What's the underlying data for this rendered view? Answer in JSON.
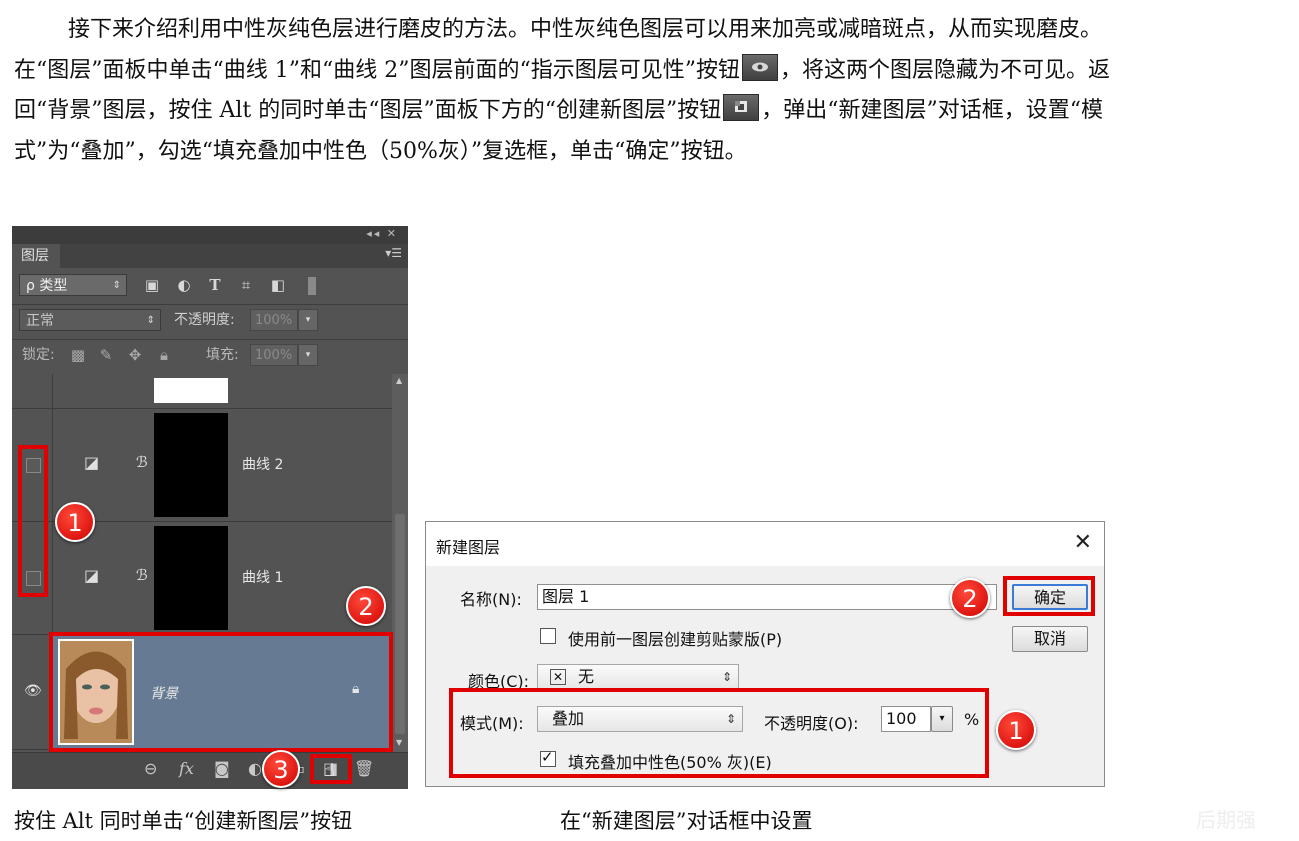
{
  "paragraph": {
    "part1": "接下来介绍利用中性灰纯色层进行磨皮的方法。中性灰纯色图层可以用来加亮或减暗斑点，从而实现磨皮。在“图层”面板中单击“曲线 1”和“曲线 2”图层前面的“指示图层可见性”按钮",
    "part2": "，将这两个图层隐藏为不可见。返回“背景”图层，按住 Alt 的同时单击“图层”面板下方的“创建新图层”按钮",
    "part3": "，弹出“新建图层”对话框，设置“模式”为“叠加”，勾选“填充叠加中性色（50%灰）”复选框，单击“确定”按钮。"
  },
  "layers_panel": {
    "tab": "图层",
    "filter_type": "ρ 类型",
    "blend_mode": "正常",
    "opacity_label": "不透明度:",
    "opacity_value": "100%",
    "lock_label": "锁定:",
    "fill_label": "填充:",
    "fill_value": "100%",
    "layers": [
      {
        "name": "曲线 2",
        "visible": false
      },
      {
        "name": "曲线 1",
        "visible": false
      },
      {
        "name": "背景",
        "visible": true,
        "selected": true
      }
    ]
  },
  "dialog": {
    "title": "新建图层",
    "name_label": "名称(N):",
    "name_value": "图层 1",
    "clip_label": "使用前一图层创建剪贴蒙版(P)",
    "color_label": "颜色(C):",
    "color_value": "无",
    "mode_label": "模式(M):",
    "mode_value": "叠加",
    "opacity_label": "不透明度(O):",
    "opacity_value": "100",
    "opacity_unit": "%",
    "fill_label": "填充叠加中性色(50% 灰)(E)",
    "ok_label": "确定",
    "cancel_label": "取消"
  },
  "badges": {
    "panel_visibility": "1",
    "panel_background": "2",
    "panel_new_layer": "3",
    "dialog_mode": "1",
    "dialog_ok": "2"
  },
  "captions": {
    "left": "按住 Alt 同时单击“创建新图层”按钮",
    "right": "在“新建图层”对话框中设置"
  },
  "watermark": "后期强",
  "colors": {
    "highlight_red": "#e10000",
    "selected_layer": "#667a93",
    "panel_bg": "#535353"
  }
}
